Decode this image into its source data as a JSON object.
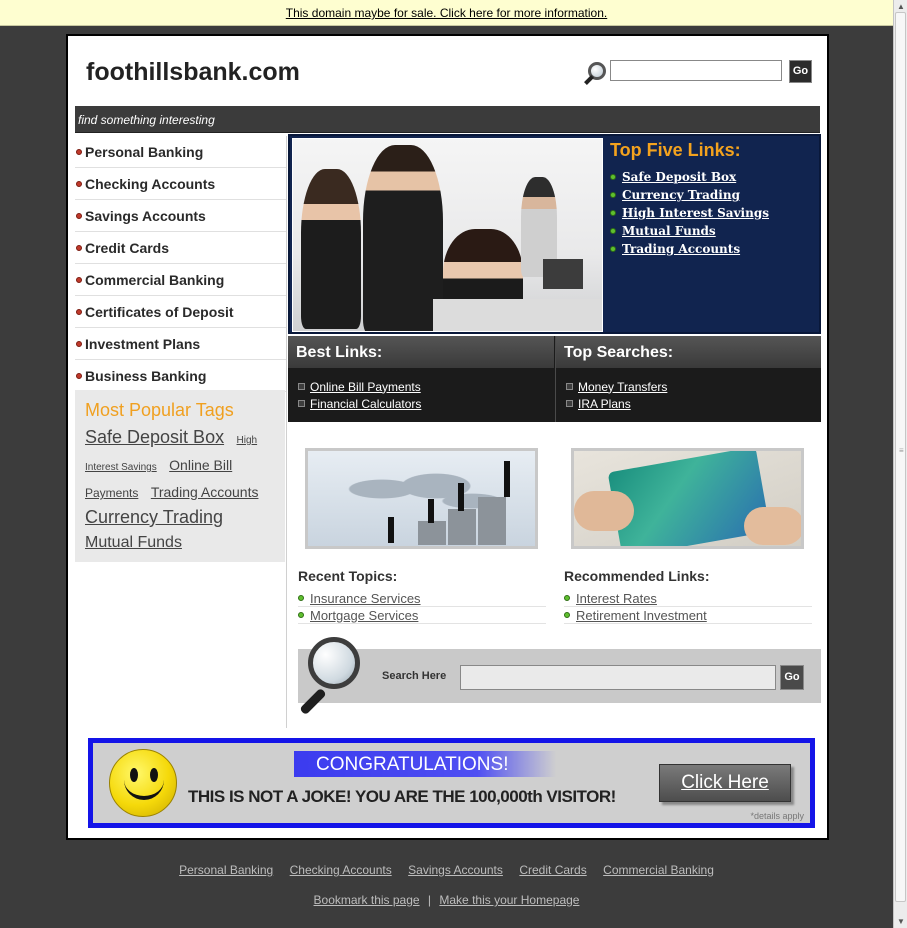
{
  "notice_bar": {
    "text": "This domain maybe for sale. Click here for more information."
  },
  "header": {
    "logo": "foothillsbank.com",
    "search": {
      "placeholder": "",
      "button": "Go"
    },
    "tagline": "find something interesting"
  },
  "left_nav": {
    "items": [
      {
        "label": "Personal Banking"
      },
      {
        "label": "Checking Accounts"
      },
      {
        "label": "Savings Accounts"
      },
      {
        "label": "Credit Cards"
      },
      {
        "label": "Commercial Banking"
      },
      {
        "label": "Certificates of Deposit"
      },
      {
        "label": "Investment Plans"
      },
      {
        "label": "Business Banking"
      }
    ]
  },
  "tags": {
    "title": "Most Popular Tags",
    "items": [
      {
        "label": "Safe Deposit Box",
        "size": "xl"
      },
      {
        "label": "High",
        "size": "xs"
      },
      {
        "label": "Interest Savings",
        "size": "xs"
      },
      {
        "label": "Online Bill",
        "size": "md"
      },
      {
        "label": "Payments",
        "size": "sm"
      },
      {
        "label": "Trading Accounts",
        "size": "md"
      },
      {
        "label": "Currency Trading",
        "size": "xl"
      },
      {
        "label": "Mutual Funds",
        "size": "lg"
      }
    ]
  },
  "feature": {
    "title": "Top Five Links:",
    "links": [
      {
        "label": "Safe Deposit Box"
      },
      {
        "label": "Currency Trading"
      },
      {
        "label": "High Interest Savings"
      },
      {
        "label": "Mutual Funds"
      },
      {
        "label": "Trading Accounts"
      }
    ]
  },
  "best_links": {
    "title": "Best Links:",
    "items": [
      {
        "label": "Online Bill Payments"
      },
      {
        "label": "Financial Calculators"
      }
    ]
  },
  "top_searches": {
    "title": "Top Searches:",
    "items": [
      {
        "label": "Money Transfers"
      },
      {
        "label": "IRA Plans"
      }
    ]
  },
  "recent_topics": {
    "title": "Recent Topics:",
    "items": [
      {
        "label": "Insurance Services"
      },
      {
        "label": "Mortgage Services"
      }
    ]
  },
  "recommended": {
    "title": "Recommended Links:",
    "items": [
      {
        "label": "Interest Rates"
      },
      {
        "label": "Retirement Investment"
      }
    ]
  },
  "bottom_search": {
    "label": "Search Here",
    "button": "Go"
  },
  "banner": {
    "congrats": "CONGRATULATIONS!",
    "message": "THIS IS NOT A JOKE! YOU ARE THE 100,000th VISITOR!",
    "button": "Click Here",
    "details": "*details apply"
  },
  "footer": {
    "links": [
      {
        "label": "Personal Banking"
      },
      {
        "label": "Checking Accounts"
      },
      {
        "label": "Savings Accounts"
      },
      {
        "label": "Credit Cards"
      },
      {
        "label": "Commercial Banking"
      }
    ],
    "bookmark": "Bookmark this page",
    "separator": "|",
    "homepage": "Make this your Homepage"
  },
  "colors": {
    "accent_orange": "#f3a21e",
    "feature_navy": "#11244f",
    "banner_blue": "#1414e8",
    "background": "#3c3c3c"
  }
}
